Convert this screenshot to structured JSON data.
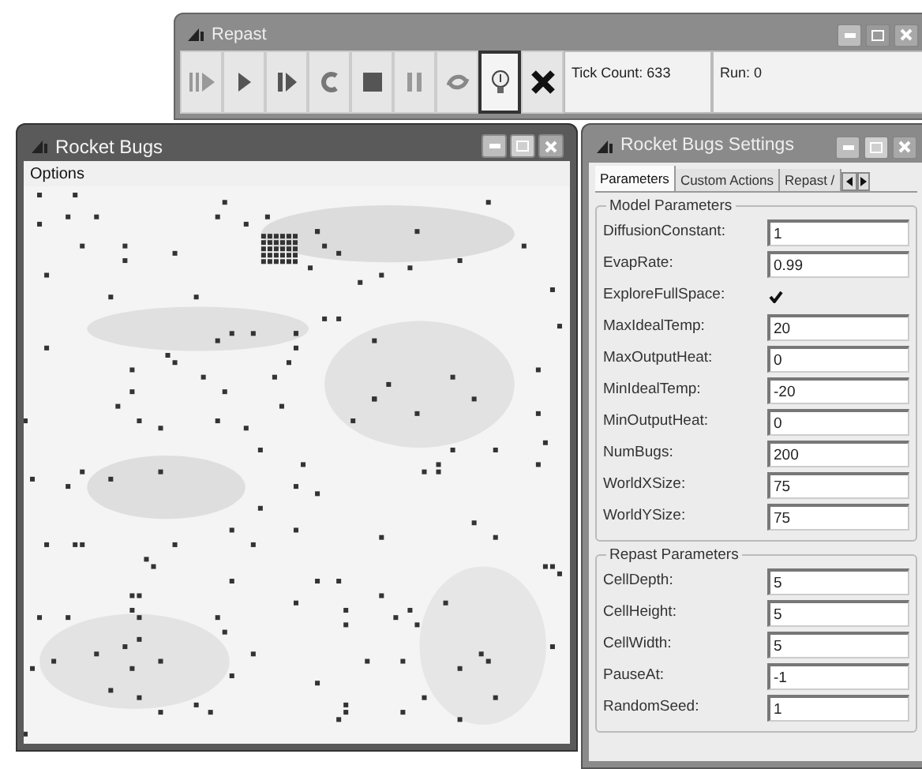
{
  "repast": {
    "title": "Repast",
    "toolbar": [
      {
        "kind": "run",
        "selected": false
      },
      {
        "kind": "play",
        "selected": false
      },
      {
        "kind": "step",
        "selected": false
      },
      {
        "kind": "reset",
        "selected": false
      },
      {
        "kind": "stop",
        "selected": false
      },
      {
        "kind": "pause",
        "selected": false
      },
      {
        "kind": "setup",
        "selected": false
      },
      {
        "kind": "bulb",
        "selected": true
      },
      {
        "kind": "exit",
        "selected": false
      }
    ],
    "tick_count": "Tick Count: 633",
    "run": "Run: 0"
  },
  "bugs_window": {
    "title": "Rocket Bugs",
    "menu": [
      "Options"
    ]
  },
  "settings": {
    "title": "Rocket Bugs Settings",
    "tabs": [
      {
        "label": "Parameters",
        "selected": true
      },
      {
        "label": "Custom Actions",
        "selected": false
      },
      {
        "label": "Repast /",
        "selected": false
      }
    ],
    "groups": [
      {
        "title": "Model Parameters",
        "fields": [
          {
            "kind": "text",
            "label": "DiffusionConstant:",
            "value": "1"
          },
          {
            "kind": "text",
            "label": "EvapRate:",
            "value": "0.99"
          },
          {
            "kind": "checkbox",
            "label": "ExploreFullSpace:",
            "checked": true
          },
          {
            "kind": "text",
            "label": "MaxIdealTemp:",
            "value": "20"
          },
          {
            "kind": "text",
            "label": "MaxOutputHeat:",
            "value": "0"
          },
          {
            "kind": "text",
            "label": "MinIdealTemp:",
            "value": "-20"
          },
          {
            "kind": "text",
            "label": "MinOutputHeat:",
            "value": "0"
          },
          {
            "kind": "text",
            "label": "NumBugs:",
            "value": "200"
          },
          {
            "kind": "text",
            "label": "WorldXSize:",
            "value": "75"
          },
          {
            "kind": "text",
            "label": "WorldYSize:",
            "value": "75"
          }
        ]
      },
      {
        "title": "Repast Parameters",
        "fields": [
          {
            "kind": "text",
            "label": "CellDepth:",
            "value": "5"
          },
          {
            "kind": "text",
            "label": "CellHeight:",
            "value": "5"
          },
          {
            "kind": "text",
            "label": "CellWidth:",
            "value": "5"
          },
          {
            "kind": "text",
            "label": "PauseAt:",
            "value": "-1"
          },
          {
            "kind": "text",
            "label": "RandomSeed:",
            "value": "1"
          }
        ]
      }
    ]
  }
}
